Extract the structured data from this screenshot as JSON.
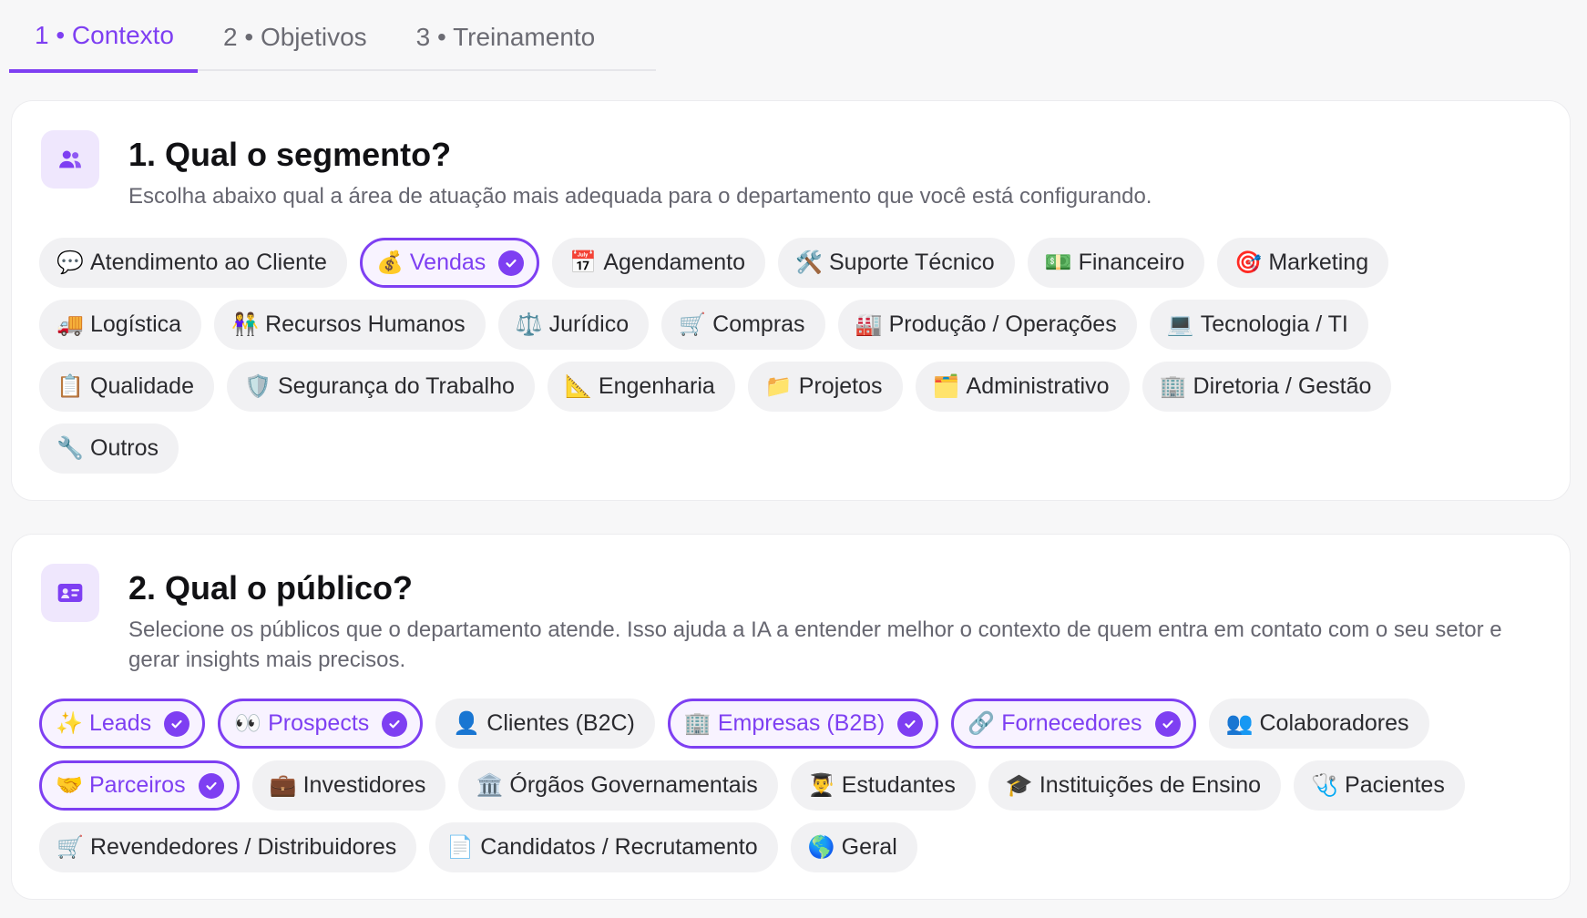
{
  "colors": {
    "accent": "#7e3ff2",
    "chip_bg": "#f1f1f3",
    "text_muted": "#666670"
  },
  "tabs": [
    {
      "label": "1 • Contexto",
      "active": true
    },
    {
      "label": "2 • Objetivos",
      "active": false
    },
    {
      "label": "3 • Treinamento",
      "active": false
    }
  ],
  "segment": {
    "icon": "users-icon",
    "title": "1. Qual o segmento?",
    "subtitle": "Escolha abaixo qual a área de atuação mais adequada para o departamento que você está configurando.",
    "options": [
      {
        "emoji": "💬",
        "label": "Atendimento ao Cliente",
        "selected": false
      },
      {
        "emoji": "💰",
        "label": "Vendas",
        "selected": true
      },
      {
        "emoji": "📅",
        "label": "Agendamento",
        "selected": false
      },
      {
        "emoji": "🛠️",
        "label": "Suporte Técnico",
        "selected": false
      },
      {
        "emoji": "💵",
        "label": "Financeiro",
        "selected": false
      },
      {
        "emoji": "🎯",
        "label": "Marketing",
        "selected": false
      },
      {
        "emoji": "🚚",
        "label": "Logística",
        "selected": false
      },
      {
        "emoji": "👫",
        "label": "Recursos Humanos",
        "selected": false
      },
      {
        "emoji": "⚖️",
        "label": "Jurídico",
        "selected": false
      },
      {
        "emoji": "🛒",
        "label": "Compras",
        "selected": false
      },
      {
        "emoji": "🏭",
        "label": "Produção / Operações",
        "selected": false
      },
      {
        "emoji": "💻",
        "label": "Tecnologia / TI",
        "selected": false
      },
      {
        "emoji": "📋",
        "label": "Qualidade",
        "selected": false
      },
      {
        "emoji": "🛡️",
        "label": "Segurança do Trabalho",
        "selected": false
      },
      {
        "emoji": "📐",
        "label": "Engenharia",
        "selected": false
      },
      {
        "emoji": "📁",
        "label": "Projetos",
        "selected": false
      },
      {
        "emoji": "🗂️",
        "label": "Administrativo",
        "selected": false
      },
      {
        "emoji": "🏢",
        "label": "Diretoria / Gestão",
        "selected": false
      },
      {
        "emoji": "🔧",
        "label": "Outros",
        "selected": false
      }
    ]
  },
  "audience": {
    "icon": "id-card-icon",
    "title": "2. Qual o público?",
    "subtitle": "Selecione os públicos que o departamento atende. Isso ajuda a IA a entender melhor o contexto de quem entra em contato com o seu setor e gerar insights mais precisos.",
    "options": [
      {
        "emoji": "✨",
        "label": "Leads",
        "selected": true
      },
      {
        "emoji": "👀",
        "label": "Prospects",
        "selected": true
      },
      {
        "emoji": "👤",
        "label": "Clientes (B2C)",
        "selected": false
      },
      {
        "emoji": "🏢",
        "label": "Empresas (B2B)",
        "selected": true
      },
      {
        "emoji": "🔗",
        "label": "Fornecedores",
        "selected": true
      },
      {
        "emoji": "👥",
        "label": "Colaboradores",
        "selected": false
      },
      {
        "emoji": "🤝",
        "label": "Parceiros",
        "selected": true
      },
      {
        "emoji": "💼",
        "label": "Investidores",
        "selected": false
      },
      {
        "emoji": "🏛️",
        "label": "Órgãos Governamentais",
        "selected": false
      },
      {
        "emoji": "👨‍🎓",
        "label": "Estudantes",
        "selected": false
      },
      {
        "emoji": "🎓",
        "label": "Instituições de Ensino",
        "selected": false
      },
      {
        "emoji": "🩺",
        "label": "Pacientes",
        "selected": false
      },
      {
        "emoji": "🛒",
        "label": "Revendedores / Distribuidores",
        "selected": false
      },
      {
        "emoji": "📄",
        "label": "Candidatos / Recrutamento",
        "selected": false
      },
      {
        "emoji": "🌎",
        "label": "Geral",
        "selected": false
      }
    ]
  }
}
